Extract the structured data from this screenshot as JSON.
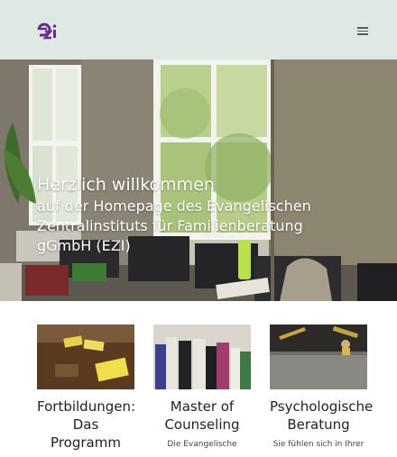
{
  "header": {
    "logo_text": "ezi",
    "menu_icon": "hamburger-icon",
    "brand_color": "#6b2c91"
  },
  "hero": {
    "title": "Herzlich willkommen",
    "subtitle": "auf der Homepage des Evangelischen Zentralinstituts für Familienberatung gGmbH (EZI)"
  },
  "cards": [
    {
      "title": "Fortbildungen: Das Programm",
      "teaser": ""
    },
    {
      "title": "Master of Counseling",
      "teaser": "Die Evangelische"
    },
    {
      "title": "Psychologische Beratung",
      "teaser": "Sie fühlen sich in Ihrer"
    }
  ]
}
